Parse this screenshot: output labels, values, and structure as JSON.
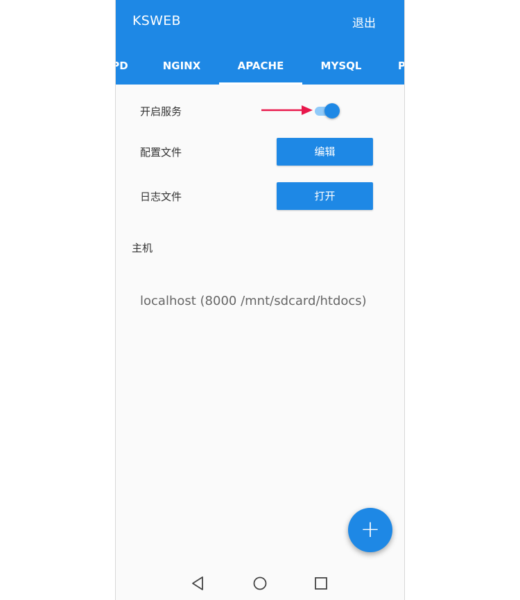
{
  "app_bar": {
    "title": "KSWEB",
    "exit_label": "退出"
  },
  "tabs": [
    {
      "label": "PD",
      "active": false
    },
    {
      "label": "NGINX",
      "active": false
    },
    {
      "label": "APACHE",
      "active": true
    },
    {
      "label": "MYSQL",
      "active": false
    },
    {
      "label": "P",
      "active": false
    }
  ],
  "settings": {
    "service_label": "开启服务",
    "service_enabled": true,
    "config_label": "配置文件",
    "edit_button": "编辑",
    "log_label": "日志文件",
    "open_button": "打开"
  },
  "hosts_section": {
    "title": "主机",
    "items": [
      {
        "text": "localhost (8000 /mnt/sdcard/htdocs)"
      }
    ]
  },
  "fab": {
    "icon": "add-icon",
    "label": "+"
  },
  "nav_bar": {
    "icons": [
      "back-icon",
      "home-icon",
      "recents-icon"
    ]
  },
  "colors": {
    "primary": "#1e88e5",
    "toggle_track": "#90caf9",
    "annotation_arrow": "#e8174b",
    "background": "#fafafa"
  }
}
